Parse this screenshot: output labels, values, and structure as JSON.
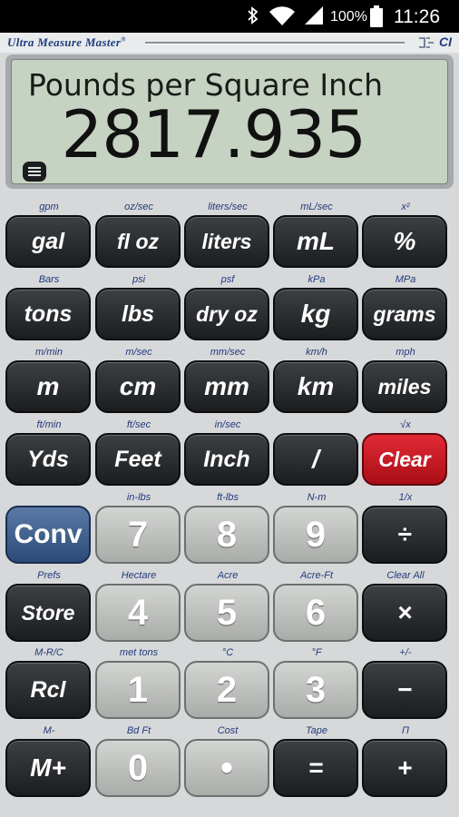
{
  "status": {
    "battery_pct": "100%",
    "time": "11:26"
  },
  "app": {
    "brand": "Ultra Measure Master",
    "brand_mark": "®",
    "model_suffix": "CI"
  },
  "display": {
    "unit_label": "Pounds per Square Inch",
    "value": "2817.935"
  },
  "menu": {
    "icon": "menu-icon"
  },
  "rows": [
    [
      {
        "label": "gal",
        "sub": "gpm",
        "style": "dark"
      },
      {
        "label": "fl oz",
        "sub": "oz/sec",
        "style": "dark"
      },
      {
        "label": "liters",
        "sub": "liters/sec",
        "style": "dark"
      },
      {
        "label": "mL",
        "sub": "mL/sec",
        "style": "dark"
      },
      {
        "label": "%",
        "sub": "x²",
        "style": "dark"
      }
    ],
    [
      {
        "label": "tons",
        "sub": "Bars",
        "style": "dark"
      },
      {
        "label": "lbs",
        "sub": "psi",
        "style": "dark"
      },
      {
        "label": "dry oz",
        "sub": "psf",
        "style": "dark"
      },
      {
        "label": "kg",
        "sub": "kPa",
        "style": "dark"
      },
      {
        "label": "grams",
        "sub": "MPa",
        "style": "dark"
      }
    ],
    [
      {
        "label": "m",
        "sub": "m/min",
        "style": "dark"
      },
      {
        "label": "cm",
        "sub": "m/sec",
        "style": "dark"
      },
      {
        "label": "mm",
        "sub": "mm/sec",
        "style": "dark"
      },
      {
        "label": "km",
        "sub": "km/h",
        "style": "dark"
      },
      {
        "label": "miles",
        "sub": "mph",
        "style": "dark"
      }
    ],
    [
      {
        "label": "Yds",
        "sub": "ft/min",
        "style": "dark"
      },
      {
        "label": "Feet",
        "sub": "ft/sec",
        "style": "dark"
      },
      {
        "label": "Inch",
        "sub": "in/sec",
        "style": "dark"
      },
      {
        "label": "/",
        "sub": "",
        "style": "dark"
      },
      {
        "label": "Clear",
        "sub": "√x",
        "style": "red"
      }
    ],
    [
      {
        "label": "Conv",
        "sub": "",
        "style": "blue"
      },
      {
        "label": "7",
        "sub": "in-lbs",
        "style": "grey"
      },
      {
        "label": "8",
        "sub": "ft-lbs",
        "style": "grey"
      },
      {
        "label": "9",
        "sub": "N-m",
        "style": "grey"
      },
      {
        "label": "÷",
        "sub": "1/x",
        "style": "dark"
      }
    ],
    [
      {
        "label": "Store",
        "sub": "Prefs",
        "style": "dark"
      },
      {
        "label": "4",
        "sub": "Hectare",
        "style": "grey"
      },
      {
        "label": "5",
        "sub": "Acre",
        "style": "grey"
      },
      {
        "label": "6",
        "sub": "Acre-Ft",
        "style": "grey"
      },
      {
        "label": "×",
        "sub": "Clear All",
        "style": "dark"
      }
    ],
    [
      {
        "label": "Rcl",
        "sub": "M-R/C",
        "style": "dark"
      },
      {
        "label": "1",
        "sub": "met tons",
        "style": "grey"
      },
      {
        "label": "2",
        "sub": "°C",
        "style": "grey"
      },
      {
        "label": "3",
        "sub": "°F",
        "style": "grey"
      },
      {
        "label": "−",
        "sub": "+/-",
        "style": "dark"
      }
    ],
    [
      {
        "label": "M+",
        "sub": "M-",
        "style": "dark"
      },
      {
        "label": "0",
        "sub": "Bd Ft",
        "style": "grey"
      },
      {
        "label": "•",
        "sub": "Cost",
        "style": "grey"
      },
      {
        "label": "=",
        "sub": "Tape",
        "style": "dark"
      },
      {
        "label": "+",
        "sub": "Π",
        "style": "dark"
      }
    ]
  ]
}
